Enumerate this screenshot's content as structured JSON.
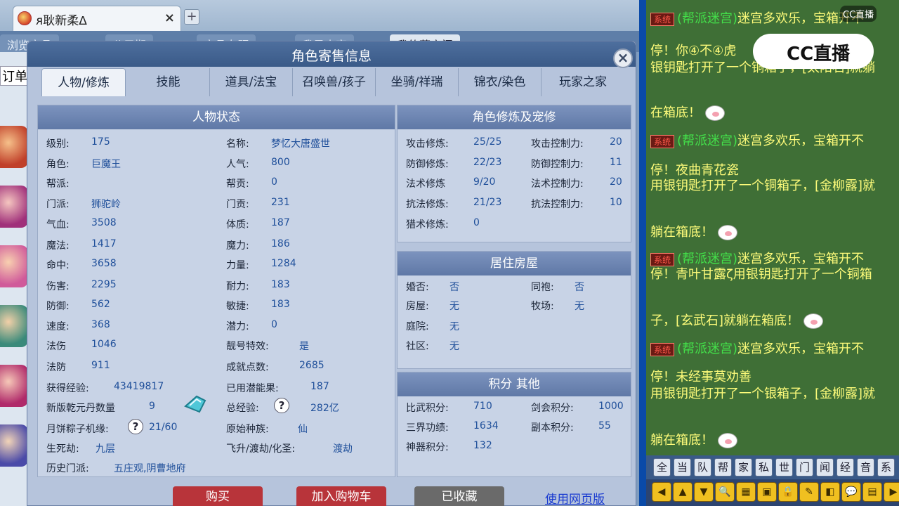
{
  "browser": {
    "tab_title": "ᴙ耿新柔ᐃ",
    "tab_close": "×",
    "new_tab": "+",
    "nav_tabs": [
      "浏览商品",
      "公示期",
      "商品专题",
      "我是卖家",
      "我的藏宝阁"
    ],
    "left_field": "订单管"
  },
  "dialog": {
    "title": "角色寄售信息",
    "close": "×",
    "tabs": [
      "人物/修炼",
      "技能",
      "道具/法宝",
      "召唤兽/孩子",
      "坐骑/祥瑞",
      "锦衣/染色",
      "玩家之家"
    ],
    "active_tab": "人物/修炼"
  },
  "status": {
    "header": "人物状态",
    "left": [
      {
        "label": "级别:",
        "value": "175"
      },
      {
        "label": "角色:",
        "value": "巨魔王"
      },
      {
        "label": "帮派:",
        "value": ""
      },
      {
        "label": "门派:",
        "value": "狮驼岭"
      },
      {
        "label": "气血:",
        "value": "3508"
      },
      {
        "label": "魔法:",
        "value": "1417"
      },
      {
        "label": "命中:",
        "value": "3658"
      },
      {
        "label": "伤害:",
        "value": "2295"
      },
      {
        "label": "防御:",
        "value": "562"
      },
      {
        "label": "速度:",
        "value": "368"
      },
      {
        "label": "法伤",
        "value": "1046"
      },
      {
        "label": "法防",
        "value": "911"
      }
    ],
    "right": [
      {
        "label": "名称:",
        "value": "梦忆大唐盛世"
      },
      {
        "label": "人气:",
        "value": "800"
      },
      {
        "label": "帮贡:",
        "value": "0"
      },
      {
        "label": "门贡:",
        "value": "231"
      },
      {
        "label": "体质:",
        "value": "187"
      },
      {
        "label": "魔力:",
        "value": "186"
      },
      {
        "label": "力量:",
        "value": "1284"
      },
      {
        "label": "耐力:",
        "value": "183"
      },
      {
        "label": "敏捷:",
        "value": "183"
      },
      {
        "label": "潜力:",
        "value": "0"
      },
      {
        "label": "靓号特效:",
        "value": "是"
      },
      {
        "label": "成就点数:",
        "value": "2685"
      }
    ],
    "exp_label": "获得经验:",
    "exp_value": "43419817",
    "potion_label": "已用潜能果:",
    "potion_value": "187",
    "qianyuan_label": "新版乾元丹数量",
    "qianyuan_value": "9",
    "total_exp_label": "总经验:",
    "total_exp_value": "282亿",
    "mooncake_label": "月饼粽子机缘:",
    "mooncake_value": "21/60",
    "race_label": "原始种族:",
    "race_value": "仙",
    "life_label": "生死劫:",
    "life_value": "九层",
    "fly_label": "飞升/渡劫/化圣:",
    "fly_value": "渡劫",
    "history_label": "历史门派:",
    "history_value": "五庄观,阴曹地府",
    "qmark": "?"
  },
  "cultivation": {
    "header": "角色修炼及宠修",
    "rows": [
      {
        "label": "攻击修炼:",
        "value": "25/25",
        "label2": "攻击控制力:",
        "value2": "20"
      },
      {
        "label": "防御修炼:",
        "value": "22/23",
        "label2": "防御控制力:",
        "value2": "11"
      },
      {
        "label": "法术修炼",
        "value": "9/20",
        "label2": "法术控制力:",
        "value2": "20"
      },
      {
        "label": "抗法修炼:",
        "value": "21/23",
        "label2": "抗法控制力:",
        "value2": "10"
      },
      {
        "label": "猎术修炼:",
        "value": "0",
        "label2": "",
        "value2": ""
      }
    ]
  },
  "housing": {
    "header": "居住房屋",
    "rows": [
      {
        "label": "婚否:",
        "value": "否",
        "label2": "同袍:",
        "value2": "否"
      },
      {
        "label": "房屋:",
        "value": "无",
        "label2": "牧场:",
        "value2": "无"
      },
      {
        "label": "庭院:",
        "value": "无",
        "label2": "",
        "value2": ""
      },
      {
        "label": "社区:",
        "value": "无",
        "label2": "",
        "value2": ""
      }
    ]
  },
  "points": {
    "header": "积分 其他",
    "rows": [
      {
        "label": "比武积分:",
        "value": "710",
        "label2": "剑会积分:",
        "value2": "1000"
      },
      {
        "label": "三界功绩:",
        "value": "1634",
        "label2": "副本积分:",
        "value2": "55"
      },
      {
        "label": "神器积分:",
        "value": "132",
        "label2": "",
        "value2": ""
      }
    ]
  },
  "buttons": {
    "buy": "购买",
    "add_cart": "加入购物车",
    "favorited": "已收藏",
    "web_link": "使用网页版"
  },
  "chat": {
    "sys_tag": "系统",
    "lines": [
      {
        "pre": "(帮派迷宫)",
        "rest": "迷宫多欢乐，宝箱开不"
      },
      {
        "pre": "停！",
        "rest": "你④不④虎"
      },
      {
        "pre": "",
        "rest": "银钥匙打开了一个铜箱子，[太阳石]就躺"
      },
      {
        "pre": "",
        "rest": "在箱底！"
      },
      {
        "pre": "(帮派迷宫)",
        "rest": "迷宫多欢乐，宝箱开不"
      },
      {
        "pre": "停！",
        "rest": "夜曲青花瓷"
      },
      {
        "pre": "",
        "rest": "用银钥匙打开了一个铜箱子，[金柳露]就"
      },
      {
        "pre": "",
        "rest": "躺在箱底！"
      },
      {
        "pre": "(帮派迷宫)",
        "rest": "迷宫多欢乐，宝箱开不"
      },
      {
        "pre": "停！",
        "rest": "青叶甘露ζ用银钥匙打开了一个铜箱"
      },
      {
        "pre": "",
        "rest": "子，[玄武石]就躺在箱底！"
      },
      {
        "pre": "(帮派迷宫)",
        "rest": "迷宫多欢乐，宝箱开不"
      },
      {
        "pre": "停！",
        "rest": "未经事莫劝善"
      },
      {
        "pre": "",
        "rest": "用银钥匙打开了一个银箱子，[金柳露]就"
      },
      {
        "pre": "",
        "rest": "躺在箱底！"
      }
    ],
    "logo": "CC直播",
    "logo_small": "CC直播",
    "tabs": [
      "全",
      "当",
      "队",
      "帮",
      "家",
      "私",
      "世",
      "门",
      "闻",
      "经",
      "音",
      "系"
    ],
    "tools": [
      "◀",
      "▲",
      "▼",
      "🔍",
      "▦",
      "▣",
      "🔒",
      "✎",
      "◧",
      "💬",
      "▤",
      "▶"
    ]
  },
  "colors": {
    "accent": "#5f78a6",
    "buy_button": "#b8343a",
    "cart_button": "#b8343a",
    "favorited_button": "#6a6a6a",
    "chat_bg": "#3f6f36"
  }
}
